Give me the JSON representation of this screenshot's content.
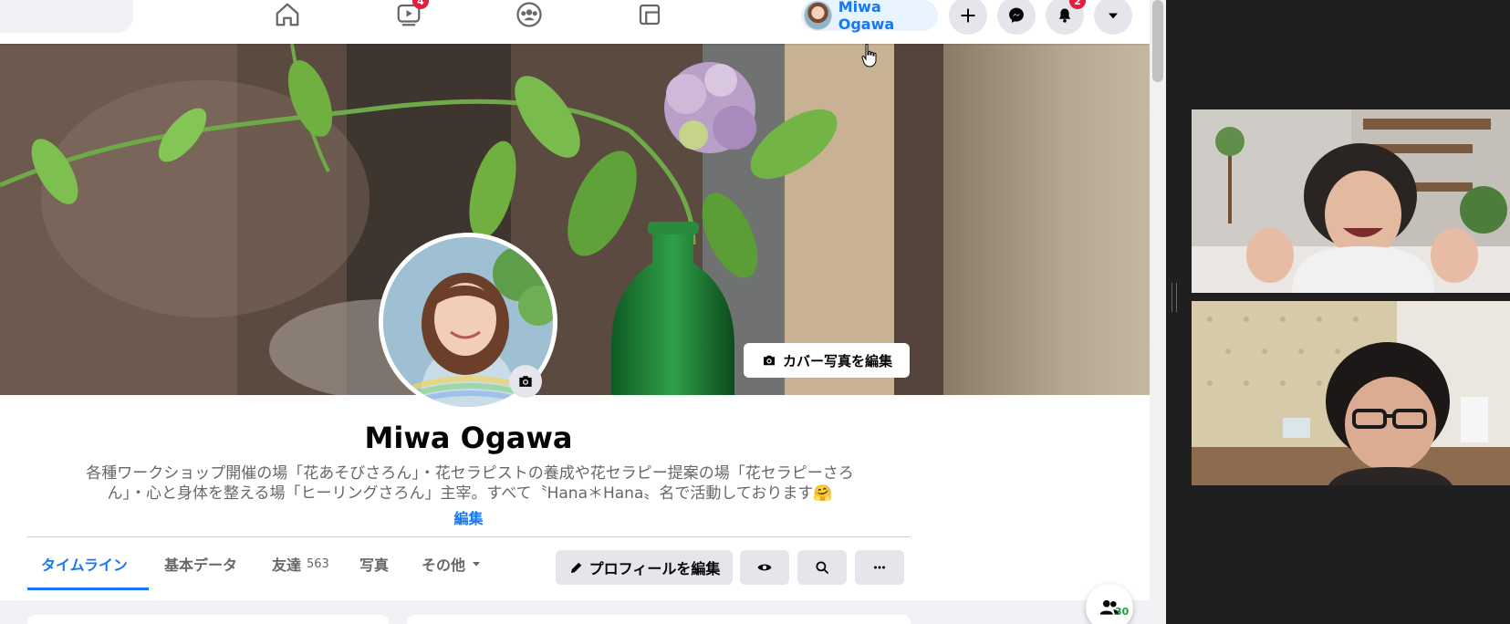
{
  "topbar": {
    "nav_icons": [
      "home-icon",
      "watch-icon",
      "groups-icon",
      "gaming-icon"
    ],
    "watch_badge": "4",
    "profile_name": "Miwa Ogawa",
    "create_icon": "plus-icon",
    "messenger_icon": "messenger-icon",
    "notifications_icon": "bell-icon",
    "notifications_badge": "2",
    "account_menu_icon": "caret-down-icon"
  },
  "cover": {
    "edit_cover_label": "カバー写真を編集"
  },
  "profile": {
    "name": "Miwa Ogawa",
    "bio_line1": "各種ワークショップ開催の場「花あそびさろん」・花セラピストの養成や花セラピー提案の場「花セラピーさろ",
    "bio_line2": "ん」・心と身体を整える場「ヒーリングさろん」主宰。すべて〝Hana＊Hana〟名で活動しております🤗",
    "bio_edit_label": "編集"
  },
  "tabs": [
    {
      "label": "タイムライン",
      "active": true
    },
    {
      "label": "基本データ"
    },
    {
      "label": "友達",
      "count": "563"
    },
    {
      "label": "写真"
    },
    {
      "label": "その他"
    }
  ],
  "actions": {
    "edit_profile_label": "プロフィールを編集",
    "view_as_icon": "eye-icon",
    "search_icon": "search-icon",
    "more_icon": "more-icon"
  },
  "friends_fab": {
    "count": "30"
  },
  "colors": {
    "accent": "#1877f2",
    "badge": "#e41e3f",
    "online": "#1c9e3a"
  }
}
